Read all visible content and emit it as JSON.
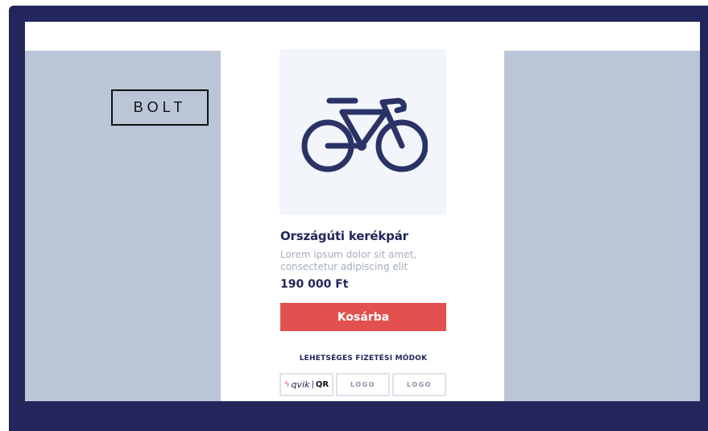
{
  "sidebar": {
    "shop_button_label": "BOLT"
  },
  "product": {
    "image_icon": "bicycle-icon",
    "title": "Országúti kerékpár",
    "description": "Lorem ipsum dolor sit amet, consectetur adipiscing elit",
    "price": "190 000 Ft",
    "cart_button_label": "Kosárba"
  },
  "payment": {
    "title": "LEHETSÉGES FIZETÉSI MÓDOK",
    "qvik_word": "qvik",
    "qvik_sep": "|",
    "qvik_qr": "QR",
    "logo1": "LOGO",
    "logo2": "LOGO"
  },
  "colors": {
    "frame": "#22265a",
    "side_panels": "#bac5d8",
    "accent": "#e2514f",
    "product_bg": "#f2f5fa"
  }
}
